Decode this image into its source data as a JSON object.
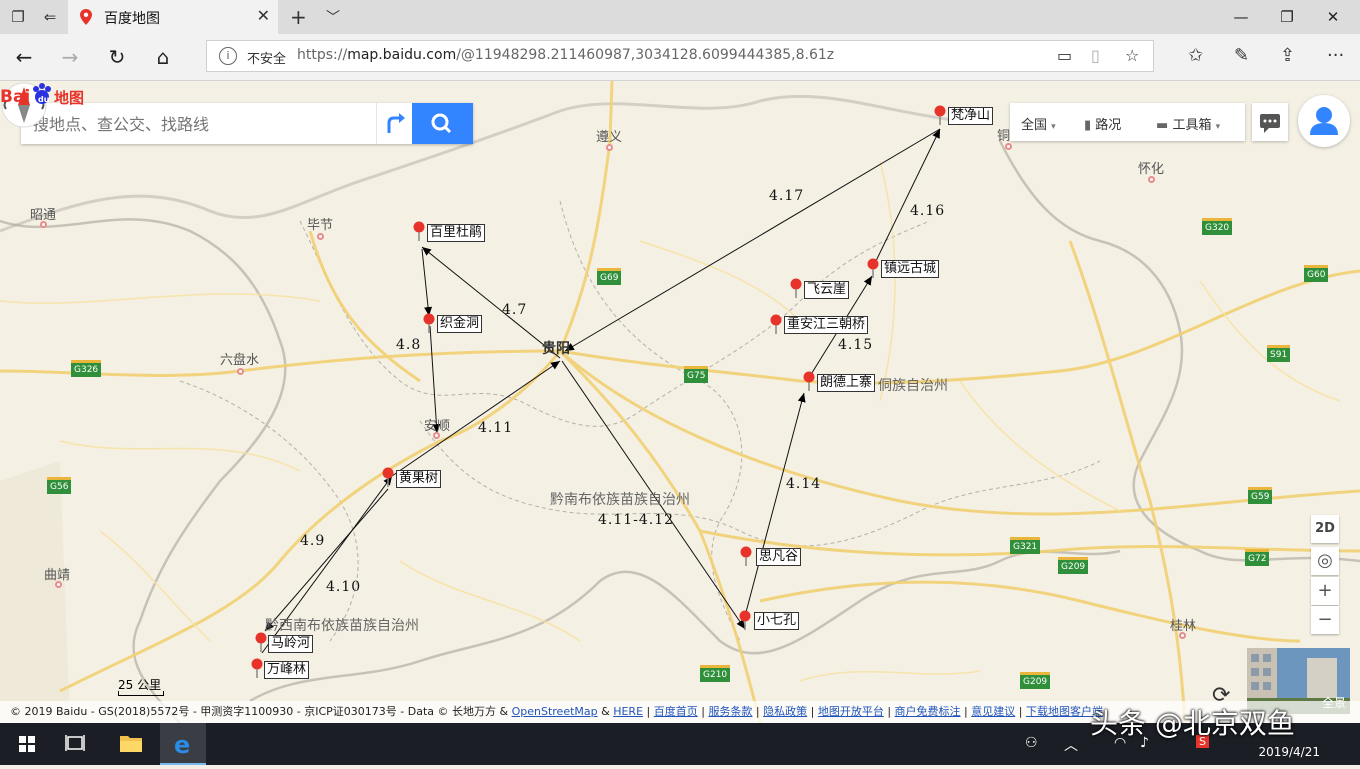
{
  "browser": {
    "tab_title": "百度地图",
    "insecure_label": "不安全",
    "url_prefix": "https://",
    "url_host": "map.baidu.com",
    "url_path": "/@11948298.211460987,3034128.6099444385,8.61z"
  },
  "search": {
    "placeholder": "搜地点、查公交、找路线"
  },
  "map_toolbar": {
    "region_label": "全国",
    "traffic_label": "路况",
    "tools_label": "工具箱"
  },
  "map_controls": {
    "mode_2d": "2D",
    "zoom_in": "+",
    "zoom_out": "−",
    "panorama_label": "全景"
  },
  "scale": "25 公里",
  "logo_text": "Bai地图",
  "copyright": {
    "prefix": "© 2019 Baidu - GS(2018)5572号 - 甲测资字1100930 - 京ICP证030173号 - Data © 长地万方 &",
    "links": [
      "OpenStreetMap",
      "HERE",
      "百度首页",
      "服务条款",
      "隐私政策",
      "地图开放平台",
      "商户免费标注",
      "意见建议",
      "下载地图客户端"
    ]
  },
  "cities": {
    "zunyi": "遵义",
    "zhaotong": "昭通",
    "bijie": "毕节",
    "liupanshui": "六盘水",
    "guiyang": "贵阳",
    "anshun": "安顺",
    "qujing": "曲靖",
    "huaihua": "怀化",
    "tong": "铜",
    "guilin": "桂林"
  },
  "regions": {
    "qiannan": "黔南布依族苗族自治州",
    "qianxinan": "黔西南布依族苗族自治州",
    "qiandongnan": "侗族自治州"
  },
  "highways": [
    "G69",
    "G75",
    "G326",
    "G56",
    "G320",
    "G60",
    "S91",
    "G59",
    "G321",
    "G209",
    "G72",
    "G210",
    "G209"
  ],
  "pois": {
    "fanjingshan": "梵净山",
    "bailidujuan": "百里杜鹃",
    "zhijindong": "织金洞",
    "huangguoshu": "黄果树",
    "malinghe": "马岭河",
    "wanfenglin": "万峰林",
    "feiyunya": "飞云崖",
    "chonganjiang": "重安江三朝桥",
    "langdeshangzhai": "朗德上寨",
    "zhenyuan": "镇远古城",
    "sifangu": "思凡谷",
    "xiaoqikong": "小七孔"
  },
  "route_dates": {
    "d47": "4.7",
    "d48": "4.8",
    "d49": "4.9",
    "d410": "4.10",
    "d411": "4.11",
    "d411_412": "4.11-4.12",
    "d414": "4.14",
    "d415": "4.15",
    "d416": "4.16",
    "d417": "4.17"
  },
  "taskbar": {
    "date": "2019/4/21"
  },
  "watermark": "头条 @北京双鱼",
  "colors": {
    "search_blue": "#3385ff",
    "pin_red": "#e8332a",
    "highway_green": "#2f8f3a"
  }
}
